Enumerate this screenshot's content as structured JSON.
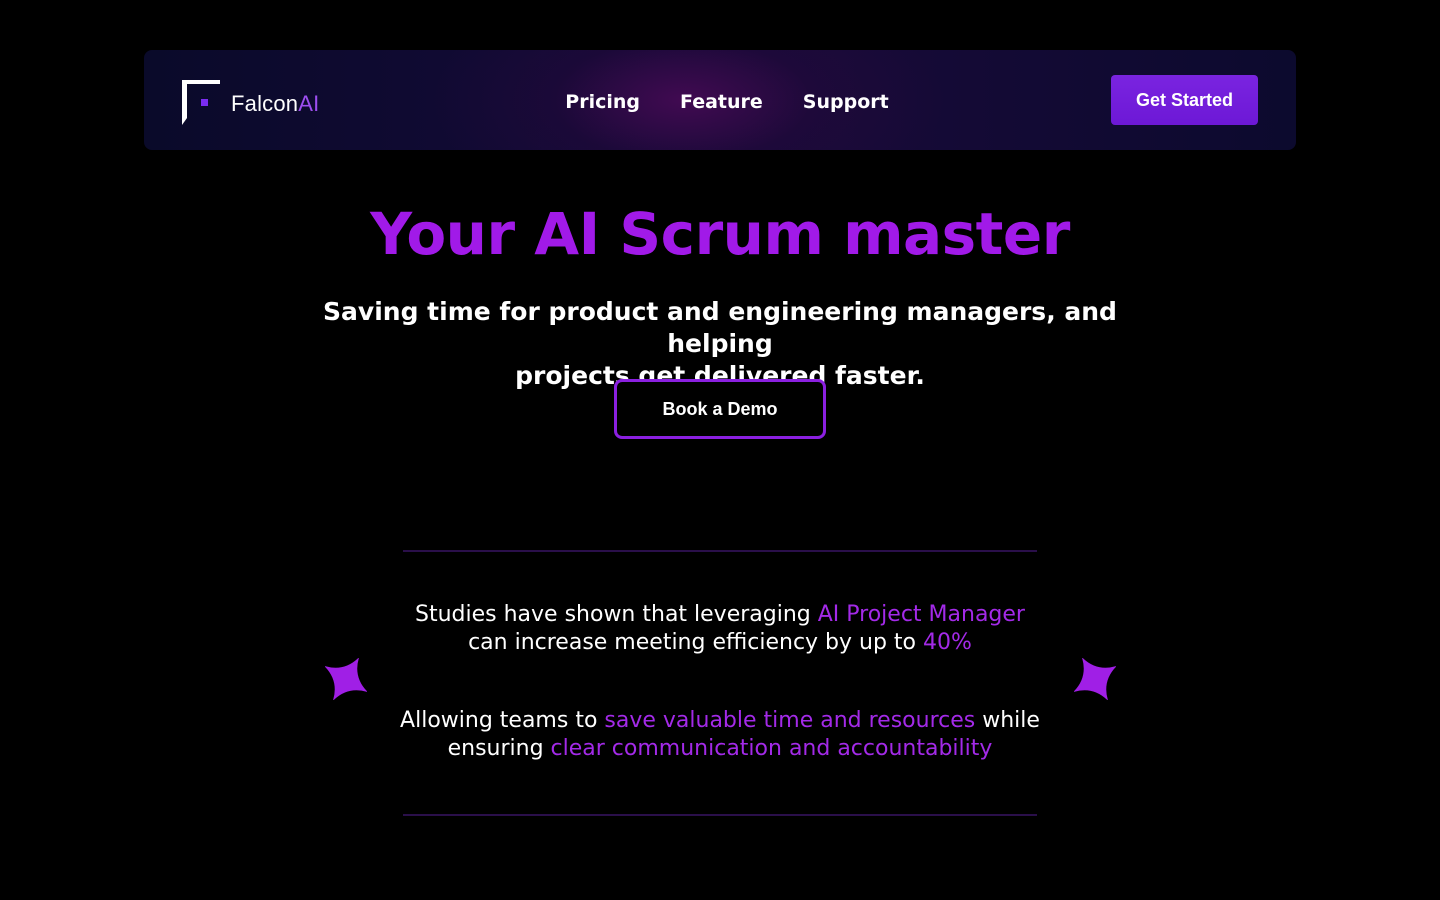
{
  "brand": {
    "name_main": "Falcon",
    "name_accent": "AI",
    "accent_color": "#9d4ef0"
  },
  "nav": {
    "items": [
      "Pricing",
      "Feature",
      "Support"
    ],
    "cta_label": "Get Started"
  },
  "hero": {
    "title": "Your AI Scrum master",
    "subtitle_line1": "Saving time for product and engineering managers, and helping",
    "subtitle_line2": "projects get delivered faster.",
    "demo_label": "Book a Demo"
  },
  "stats": {
    "line1_prefix": "Studies have shown that leveraging ",
    "line1_highlight": "AI Project Manager",
    "line2_prefix": "can increase meeting efficiency by up to ",
    "line2_highlight": "40%",
    "line3_prefix": "Allowing teams to ",
    "line3_highlight": "save valuable time and resources",
    "line3_suffix": " while",
    "line4_prefix": "ensuring ",
    "line4_highlight": "clear communication and accountability"
  },
  "colors": {
    "background": "#000000",
    "primary_purple": "#a11ae8",
    "button_purple": "#7a24e0",
    "highlight_purple": "#a32ae8",
    "divider": "#2a0f4a"
  },
  "icons": {
    "logo": "falcon-logo-icon",
    "decor": "sparkle-icon"
  }
}
